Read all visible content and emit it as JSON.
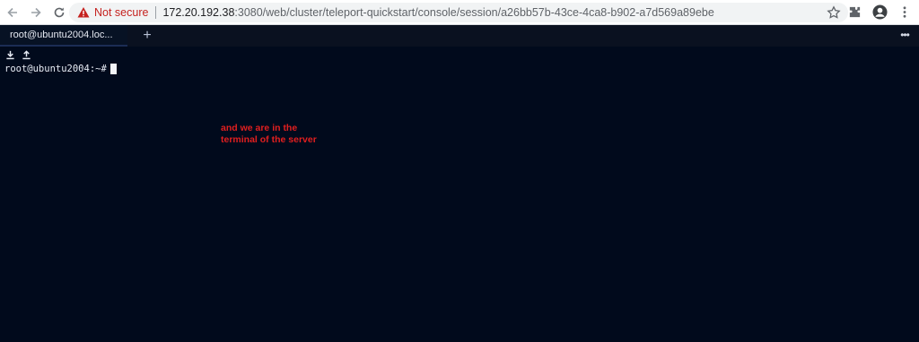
{
  "browser": {
    "security_label": "Not secure",
    "url_host": "172.20.192.38",
    "url_rest": ":3080/web/cluster/teleport-quickstart/console/session/a26bb57b-43ce-4ca8-b902-a7d569a89ebe"
  },
  "tabs": [
    {
      "label": "root@ubuntu2004.loc..."
    }
  ],
  "tab_add_label": "+",
  "terminal": {
    "prompt": "root@ubuntu2004:~#"
  },
  "annotation": {
    "line1": "and we are in the",
    "line2": "terminal of the server",
    "color": "#e21f1f"
  }
}
